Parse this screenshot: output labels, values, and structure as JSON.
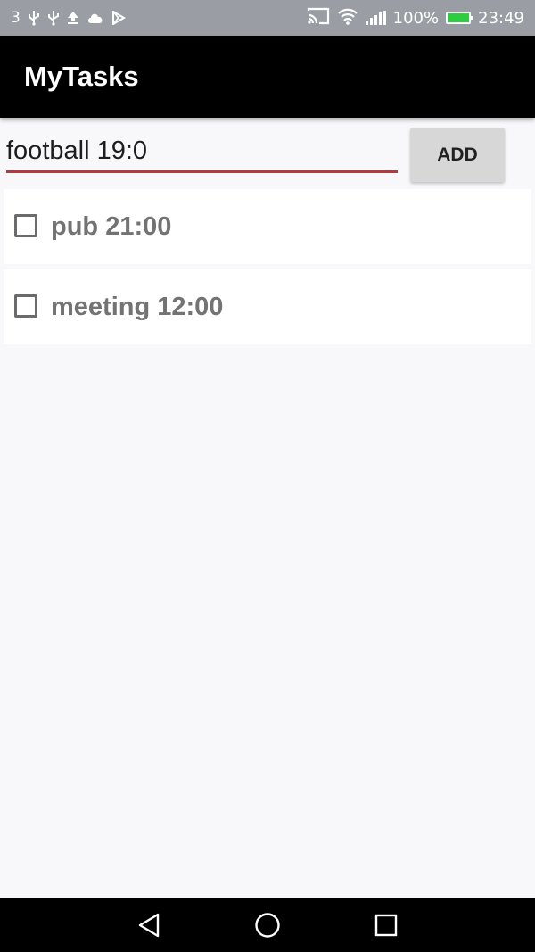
{
  "status_bar": {
    "notification_count": "3",
    "battery_level": "100%",
    "time": "23:49",
    "left_icons": [
      "usb-icon",
      "usb-icon",
      "upload-icon",
      "cloud-icon",
      "play-store-icon"
    ],
    "right_icons": [
      "cast-icon",
      "wifi-icon",
      "signal-icon",
      "battery-icon"
    ]
  },
  "app_bar": {
    "title": "MyTasks"
  },
  "new_task": {
    "input_value": "football 19:0",
    "add_label": "ADD"
  },
  "tasks": [
    {
      "label": "pub 21:00",
      "checked": false
    },
    {
      "label": "meeting 12:00",
      "checked": false
    }
  ],
  "nav_bar": {
    "buttons": [
      "back-icon",
      "home-icon",
      "recents-icon"
    ]
  },
  "colors": {
    "status_bar_bg": "#9a9ea4",
    "app_bar_bg": "#000000",
    "accent_underline": "#b23a3f",
    "button_bg": "#d7d7d7",
    "task_text": "#737373",
    "battery_fill": "#2ecc40"
  }
}
